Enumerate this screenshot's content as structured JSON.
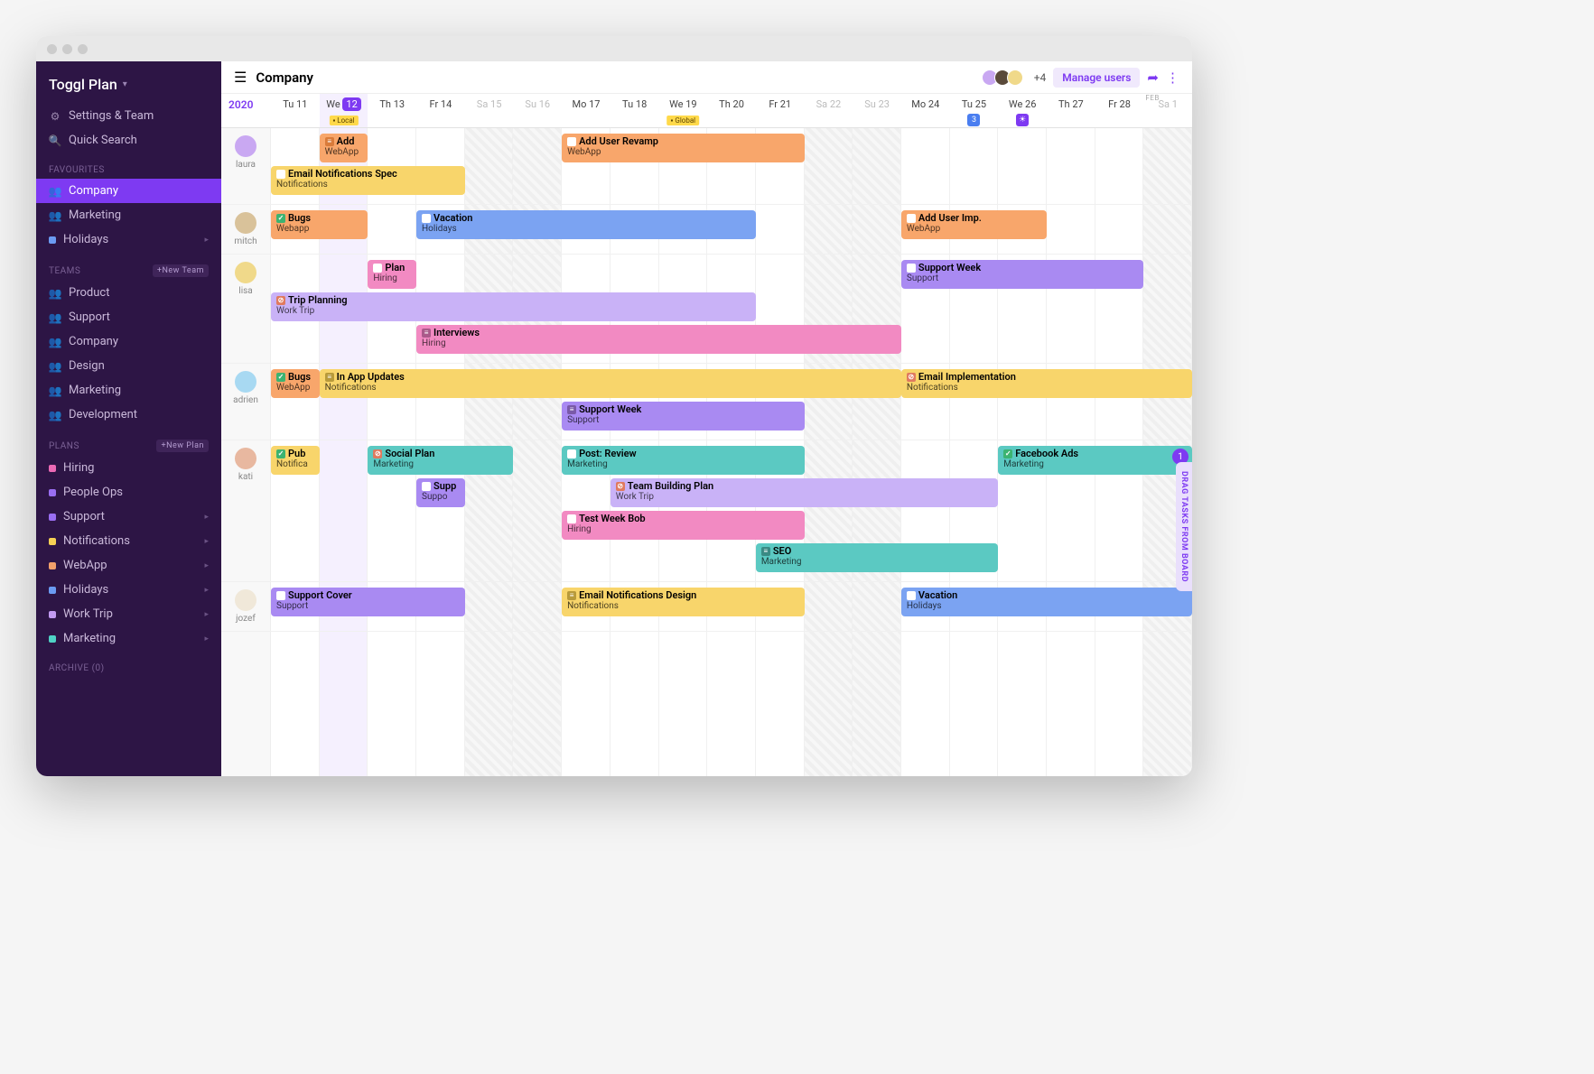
{
  "brand": "Toggl Plan",
  "sidebar": {
    "settings": "Settings & Team",
    "search": "Quick Search",
    "sections": {
      "favourites": {
        "label": "FAVOURITES",
        "items": [
          {
            "label": "Company",
            "type": "team",
            "active": true
          },
          {
            "label": "Marketing",
            "type": "team"
          },
          {
            "label": "Holidays",
            "type": "plan",
            "color": "#6b9bf2",
            "chevron": true
          }
        ]
      },
      "teams": {
        "label": "TEAMS",
        "badge": "+New Team",
        "items": [
          {
            "label": "Product"
          },
          {
            "label": "Support"
          },
          {
            "label": "Company"
          },
          {
            "label": "Design"
          },
          {
            "label": "Marketing"
          },
          {
            "label": "Development"
          }
        ]
      },
      "plans": {
        "label": "PLANS",
        "badge": "+New Plan",
        "items": [
          {
            "label": "Hiring",
            "color": "#ec6ab5",
            "icon": "board"
          },
          {
            "label": "People Ops",
            "color": "#9a6ef2",
            "icon": "board"
          },
          {
            "label": "Support",
            "color": "#9a6ef2",
            "chevron": true
          },
          {
            "label": "Notifications",
            "color": "#f7d154",
            "chevron": true
          },
          {
            "label": "WebApp",
            "color": "#f2a06b",
            "chevron": true
          },
          {
            "label": "Holidays",
            "color": "#6b9bf2",
            "chevron": true
          },
          {
            "label": "Work Trip",
            "color": "#c29af2",
            "chevron": true
          },
          {
            "label": "Marketing",
            "color": "#4fd1c5",
            "chevron": true
          }
        ]
      },
      "archive": {
        "label": "ARCHIVE (0)"
      }
    }
  },
  "header": {
    "title": "Company",
    "extraAvatars": "+4",
    "manage": "Manage users"
  },
  "timeline": {
    "year": "2020",
    "monthLabel": "FEB",
    "days": [
      {
        "lbl": "Tu",
        "num": "11"
      },
      {
        "lbl": "We",
        "num": "12",
        "today": true,
        "milestone": "Local",
        "msClass": "ms-local"
      },
      {
        "lbl": "Th",
        "num": "13"
      },
      {
        "lbl": "Fr",
        "num": "14"
      },
      {
        "lbl": "Sa",
        "num": "15",
        "weekend": true
      },
      {
        "lbl": "Su",
        "num": "16",
        "weekend": true
      },
      {
        "lbl": "Mo",
        "num": "17"
      },
      {
        "lbl": "Tu",
        "num": "18"
      },
      {
        "lbl": "We",
        "num": "19",
        "milestone": "Global",
        "msClass": "ms-global"
      },
      {
        "lbl": "Th",
        "num": "20"
      },
      {
        "lbl": "Fr",
        "num": "21"
      },
      {
        "lbl": "Sa",
        "num": "22",
        "weekend": true
      },
      {
        "lbl": "Su",
        "num": "23",
        "weekend": true
      },
      {
        "lbl": "Mo",
        "num": "24"
      },
      {
        "lbl": "Tu",
        "num": "25",
        "msIcon": "3",
        "msIconClass": "ms-blue"
      },
      {
        "lbl": "We",
        "num": "26",
        "msIcon": "☀",
        "msIconClass": "ms-purple"
      },
      {
        "lbl": "Th",
        "num": "27"
      },
      {
        "lbl": "Fr",
        "num": "28"
      },
      {
        "lbl": "Sa",
        "num": "1",
        "weekend": true,
        "monthStart": true
      }
    ]
  },
  "colors": {
    "orange": "#f8a66b",
    "yellow": "#f8d56b",
    "blue": "#7ba3f2",
    "pink": "#f28ac2",
    "purple": "#a98af2",
    "lilac": "#c9b2f7",
    "teal": "#5bc9c2",
    "green": "#6fd49f"
  },
  "people": [
    {
      "name": "laura",
      "avatar": "#c9a8f2",
      "rows": [
        [
          {
            "title": "Add",
            "sub": "WebApp",
            "color": "orange",
            "start": 1,
            "span": 1,
            "icon": "≡",
            "iconBg": "#d97b3a"
          },
          {
            "title": "Add User Revamp",
            "sub": "WebApp",
            "color": "orange",
            "start": 6,
            "span": 5,
            "icon": "⬤",
            "iconBg": "#fff"
          }
        ],
        [
          {
            "title": "Email Notifications Spec",
            "sub": "Notifications",
            "color": "yellow",
            "start": 0,
            "span": 4,
            "icon": "⬤",
            "iconBg": "#fff"
          }
        ]
      ]
    },
    {
      "name": "mitch",
      "avatar": "#d9c29a",
      "rows": [
        [
          {
            "title": "Bugs",
            "sub": "Webapp",
            "color": "orange",
            "start": 0,
            "span": 2,
            "icon": "✓",
            "iconBg": "#3cb371"
          },
          {
            "title": "Vacation",
            "sub": "Holidays",
            "color": "blue",
            "start": 3,
            "span": 7,
            "icon": "⬤",
            "iconBg": "#fff"
          },
          {
            "title": "Add User Imp.",
            "sub": "WebApp",
            "color": "orange",
            "start": 13,
            "span": 3,
            "icon": "⬤",
            "iconBg": "#fff"
          }
        ]
      ]
    },
    {
      "name": "lisa",
      "avatar": "#f0d98a",
      "rows": [
        [
          {
            "title": "Plan",
            "sub": "Hiring",
            "color": "pink",
            "start": 2,
            "span": 1,
            "icon": "⬤",
            "iconBg": "#fff"
          },
          {
            "title": "Support Week",
            "sub": "Support",
            "color": "purple",
            "start": 13,
            "span": 5,
            "icon": "⬤",
            "iconBg": "#fff"
          }
        ],
        [
          {
            "title": "Trip Planning",
            "sub": "Work Trip",
            "color": "lilac",
            "start": 0,
            "span": 10,
            "icon": "⊘",
            "iconBg": "#e07a5f"
          }
        ],
        [
          {
            "title": "Interviews",
            "sub": "Hiring",
            "color": "pink",
            "start": 3,
            "span": 10,
            "icon": "≡",
            "iconBg": "#aa5a8a"
          }
        ]
      ]
    },
    {
      "name": "adrien",
      "avatar": "#a8d9f2",
      "rows": [
        [
          {
            "title": "Bugs",
            "sub": "WebApp",
            "color": "orange",
            "start": 0,
            "span": 1,
            "icon": "✓",
            "iconBg": "#3cb371"
          },
          {
            "title": "In App Updates",
            "sub": "Notifications",
            "color": "yellow",
            "start": 1,
            "span": 12,
            "icon": "≡",
            "iconBg": "#b89a3a"
          },
          {
            "title": "Email Implementation",
            "sub": "Notifications",
            "color": "yellow",
            "start": 13,
            "span": 6,
            "icon": "⊘",
            "iconBg": "#e07a5f"
          }
        ],
        [
          {
            "title": "Support Week",
            "sub": "Support",
            "color": "purple",
            "start": 6,
            "span": 5,
            "icon": "≡",
            "iconBg": "#7a5aa8"
          }
        ]
      ]
    },
    {
      "name": "kati",
      "avatar": "#e8b8a0",
      "rows": [
        [
          {
            "title": "Pub",
            "sub": "Notifica",
            "color": "yellow",
            "start": 0,
            "span": 1,
            "icon": "✓",
            "iconBg": "#3cb371"
          },
          {
            "title": "Social Plan",
            "sub": "Marketing",
            "color": "teal",
            "start": 2,
            "span": 3,
            "icon": "⊘",
            "iconBg": "#e07a5f"
          },
          {
            "title": "Post: Review",
            "sub": "Marketing",
            "color": "teal",
            "start": 6,
            "span": 5,
            "icon": "⬤",
            "iconBg": "#fff"
          },
          {
            "title": "Facebook Ads",
            "sub": "Marketing",
            "color": "teal",
            "start": 15,
            "span": 4,
            "icon": "✓",
            "iconBg": "#3cb371"
          }
        ],
        [
          {
            "title": "Supp",
            "sub": "Suppo",
            "color": "purple",
            "start": 3,
            "span": 1,
            "icon": "⬤",
            "iconBg": "#fff"
          },
          {
            "title": "Team Building Plan",
            "sub": "Work Trip",
            "color": "lilac",
            "start": 7,
            "span": 8,
            "icon": "⊘",
            "iconBg": "#e07a5f"
          }
        ],
        [
          {
            "title": "Test Week Bob",
            "sub": "Hiring",
            "color": "pink",
            "start": 6,
            "span": 5,
            "icon": "⬤",
            "iconBg": "#fff"
          }
        ],
        [
          {
            "title": "SEO",
            "sub": "Marketing",
            "color": "teal",
            "start": 10,
            "span": 5,
            "icon": "≡",
            "iconBg": "#3a8a84"
          }
        ]
      ]
    },
    {
      "name": "jozef",
      "avatar": "#f0e8d9",
      "rows": [
        [
          {
            "title": "Support Cover",
            "sub": "Support",
            "color": "purple",
            "start": 0,
            "span": 4,
            "icon": "⬤",
            "iconBg": "#fff"
          },
          {
            "title": "Email Notifications Design",
            "sub": "Notifications",
            "color": "yellow",
            "start": 6,
            "span": 5,
            "icon": "≡",
            "iconBg": "#b89a3a"
          },
          {
            "title": "Vacation",
            "sub": "Holidays",
            "color": "blue",
            "start": 13,
            "span": 6,
            "icon": "⬤",
            "iconBg": "#fff"
          }
        ]
      ]
    }
  ],
  "dragTab": {
    "label": "DRAG TASKS FROM BOARD",
    "count": "1"
  }
}
